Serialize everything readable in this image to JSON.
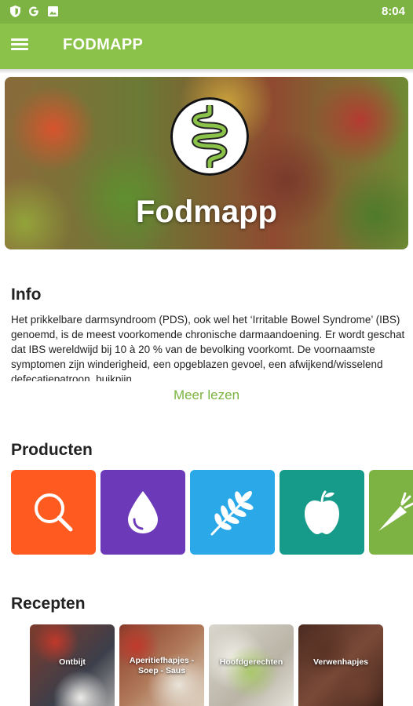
{
  "status_bar": {
    "time": "8:04",
    "icons": [
      "shield-icon",
      "google-icon",
      "image-icon"
    ]
  },
  "app_bar": {
    "title": "FODMAPP",
    "menu_icon": "hamburger-menu-icon"
  },
  "hero": {
    "title": "Fodmapp",
    "logo_icon": "intestine-logo-icon"
  },
  "info": {
    "title": "Info",
    "text": "Het prikkelbare darmsyndroom (PDS), ook wel het ‘Irritable Bowel Syndrome’ (IBS) genoemd, is de meest voorkomende chronische darmaandoening. Er wordt geschat dat IBS wereldwijd bij 10 à 20 % van de bevolking voorkomt. De voornaamste symptomen zijn winderigheid, een opgeblazen gevoel, een afwijkend/wisselend defecatiepatroon, buikpijn, …",
    "more": "Meer lezen"
  },
  "products": {
    "title": "Producten",
    "tiles": [
      {
        "icon": "search-icon",
        "color": "#ff5a1f"
      },
      {
        "icon": "drop-icon",
        "color": "#6c3ab8"
      },
      {
        "icon": "wheat-icon",
        "color": "#2aa8e8"
      },
      {
        "icon": "apple-icon",
        "color": "#169a8a"
      },
      {
        "icon": "carrot-icon",
        "color": "#7cb342"
      }
    ]
  },
  "recipes": {
    "title": "Recepten",
    "items": [
      {
        "label": "Ontbijt"
      },
      {
        "label": "Aperitiefhapjes - Soep - Saus"
      },
      {
        "label": "Hoofdgerechten"
      },
      {
        "label": "Verwenhapjes"
      }
    ]
  },
  "colors": {
    "primary": "#8bc34a",
    "primary_dark": "#7cb342",
    "accent_link": "#7cb342"
  }
}
